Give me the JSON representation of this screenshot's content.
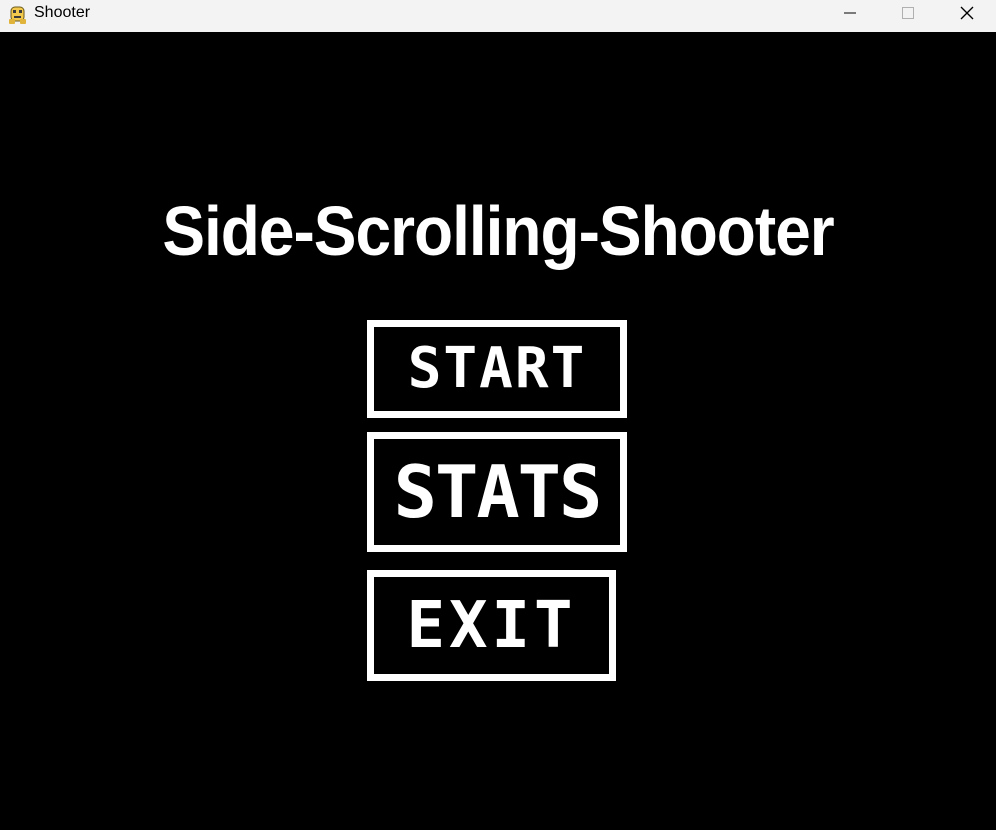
{
  "window": {
    "title": "Shooter",
    "icon": "python-icon",
    "controls": [
      "minimize-icon",
      "maximize-icon",
      "close-icon"
    ]
  },
  "game": {
    "title": "Side-Scrolling-Shooter",
    "menu": {
      "start_label": "START",
      "stats_label": "STATS",
      "exit_label": "EXIT"
    }
  },
  "colors": {
    "background": "#000000",
    "foreground": "#ffffff",
    "titlebar": "#f3f3f3"
  }
}
